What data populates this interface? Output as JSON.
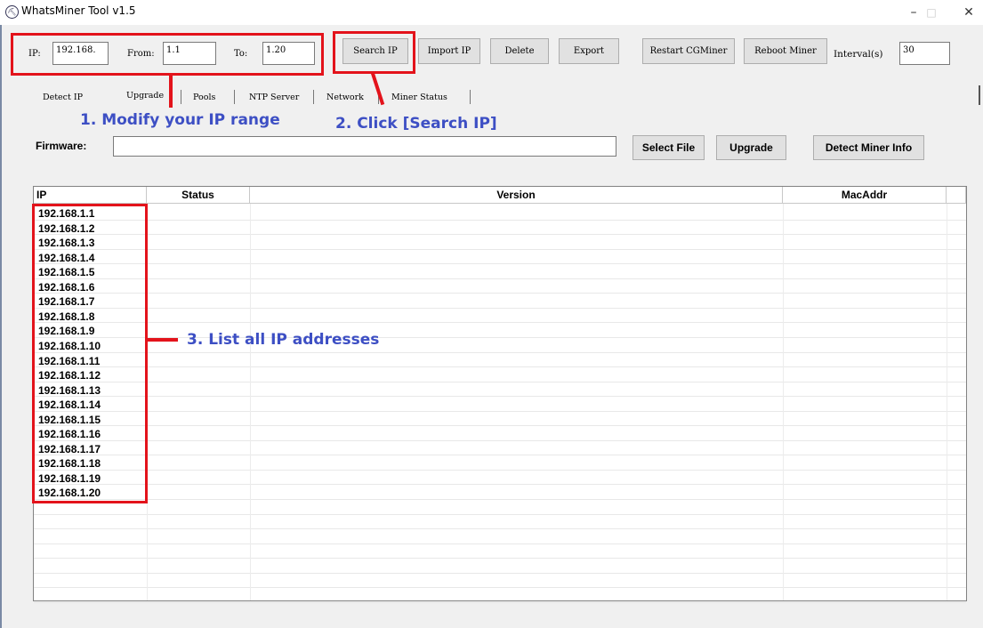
{
  "window": {
    "title": "WhatsMiner Tool v1.5",
    "minimize": "–",
    "maximize": "□",
    "close": "✕"
  },
  "toolbar": {
    "ip_label": "IP:",
    "ip_value": "192.168.",
    "from_label": "From:",
    "from_value": "1.1",
    "to_label": "To:",
    "to_value": "1.20",
    "search_ip": "Search IP",
    "import_ip": "Import IP",
    "delete": "Delete",
    "export": "Export",
    "restart_cgminer": "Restart CGMiner",
    "reboot_miner": "Reboot Miner",
    "interval_label": "Interval(s)",
    "interval_value": "30"
  },
  "tabs": [
    "Detect IP",
    "Upgrade",
    "Pools",
    "NTP Server",
    "Network",
    "Miner Status"
  ],
  "firmware": {
    "label": "Firmware:",
    "value": "",
    "select_file": "Select File",
    "upgrade": "Upgrade",
    "detect_info": "Detect Miner Info"
  },
  "table": {
    "columns": [
      "IP",
      "Status",
      "Version",
      "MacAddr"
    ],
    "rows": [
      "192.168.1.1",
      "192.168.1.2",
      "192.168.1.3",
      "192.168.1.4",
      "192.168.1.5",
      "192.168.1.6",
      "192.168.1.7",
      "192.168.1.8",
      "192.168.1.9",
      "192.168.1.10",
      "192.168.1.11",
      "192.168.1.12",
      "192.168.1.13",
      "192.168.1.14",
      "192.168.1.15",
      "192.168.1.16",
      "192.168.1.17",
      "192.168.1.18",
      "192.168.1.19",
      "192.168.1.20"
    ]
  },
  "annotations": {
    "step1": "1. Modify your IP range",
    "step2": "2. Click [Search IP]",
    "step3": "3. List all IP addresses"
  },
  "colors": {
    "annotation_red": "#e3131b",
    "annotation_blue": "#3d4fc4"
  }
}
